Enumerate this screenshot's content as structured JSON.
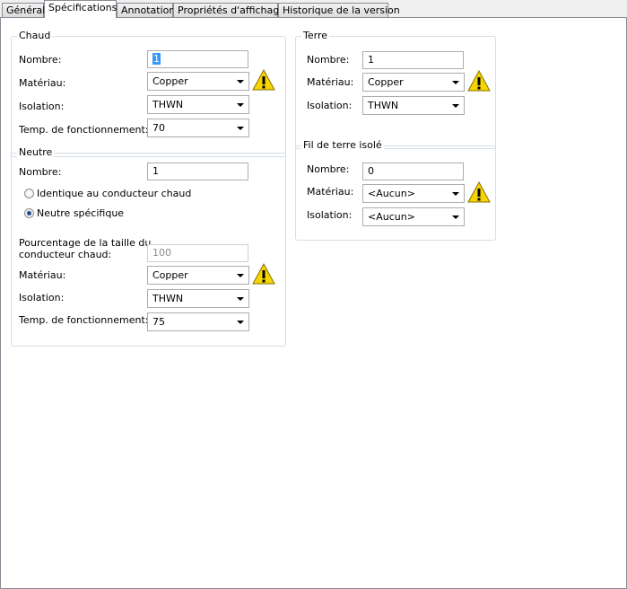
{
  "tabs": [
    "Général",
    "Spécifications",
    "Annotation",
    "Propriétés d'affichage",
    "Historique de la version"
  ],
  "chaud": {
    "title": "Chaud",
    "nombre_label": "Nombre:",
    "nombre_value": "1",
    "materiau_label": "Matériau:",
    "materiau_value": "Copper",
    "isolation_label": "Isolation:",
    "isolation_value": "THWN",
    "temp_label": "Temp. de fonctionnement:",
    "temp_value": "70"
  },
  "neutre": {
    "title": "Neutre",
    "nombre_label": "Nombre:",
    "nombre_value": "1",
    "radio_identique": "Identique au conducteur chaud",
    "radio_specifique": "Neutre spécifique",
    "pourcentage_label_1": "Pourcentage de la taille du",
    "pourcentage_label_2": "conducteur chaud:",
    "pourcentage_value": "100",
    "materiau_label": "Matériau:",
    "materiau_value": "Copper",
    "isolation_label": "Isolation:",
    "isolation_value": "THWN",
    "temp_label": "Temp. de fonctionnement:",
    "temp_value": "75"
  },
  "terre": {
    "title": "Terre",
    "nombre_label": "Nombre:",
    "nombre_value": "1",
    "materiau_label": "Matériau:",
    "materiau_value": "Copper",
    "isolation_label": "Isolation:",
    "isolation_value": "THWN"
  },
  "fil_terre_isole": {
    "title": "Fil de terre isolé",
    "nombre_label": "Nombre:",
    "nombre_value": "0",
    "materiau_label": "Matériau:",
    "materiau_value": "<Aucun>",
    "isolation_label": "Isolation:",
    "isolation_value": "<Aucun>"
  },
  "icons": {
    "warning": "warning-icon",
    "dropdown": "chevron-down-icon"
  },
  "colors": {
    "warning_fill": "#f5d400",
    "selection": "#3399ff",
    "radio_dot": "#1f4e8c"
  }
}
